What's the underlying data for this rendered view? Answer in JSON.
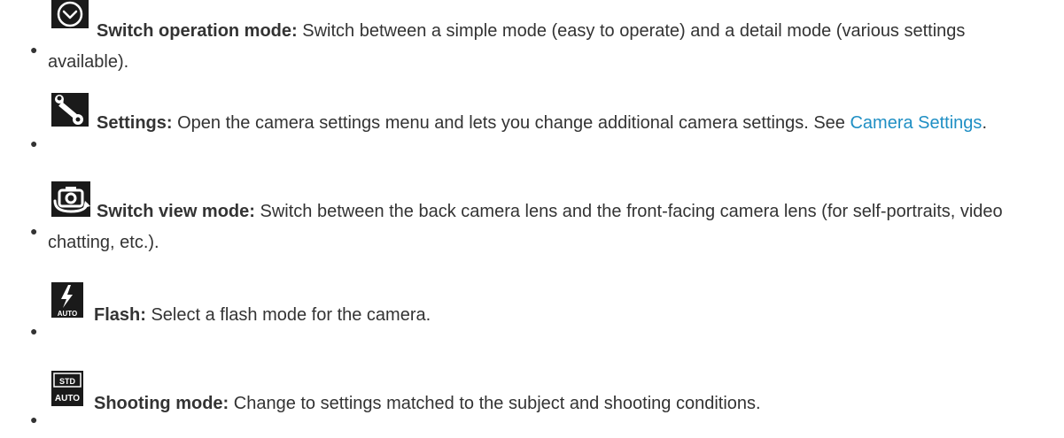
{
  "items": [
    {
      "icon": "switch-operation-mode-icon",
      "label": "Switch operation mode:",
      "text": " Switch between a simple mode (easy to operate) and a detail mode (various settings available)."
    },
    {
      "icon": "settings-wrench-icon",
      "label": "Settings:",
      "text": " Open the camera settings menu and lets you change additional camera settings. See ",
      "link": "Camera Settings",
      "after_link": "."
    },
    {
      "icon": "switch-view-mode-icon",
      "label": "Switch view mode:",
      "text": " Switch between the back camera lens and the front-facing camera lens (for self-portraits, video chatting, etc.)."
    },
    {
      "icon": "flash-auto-icon",
      "label": "Flash:",
      "text": " Select a flash mode for the camera."
    },
    {
      "icon": "shooting-mode-std-auto-icon",
      "label": "Shooting mode:",
      "text": " Change to settings matched to the subject and shooting conditions."
    }
  ]
}
